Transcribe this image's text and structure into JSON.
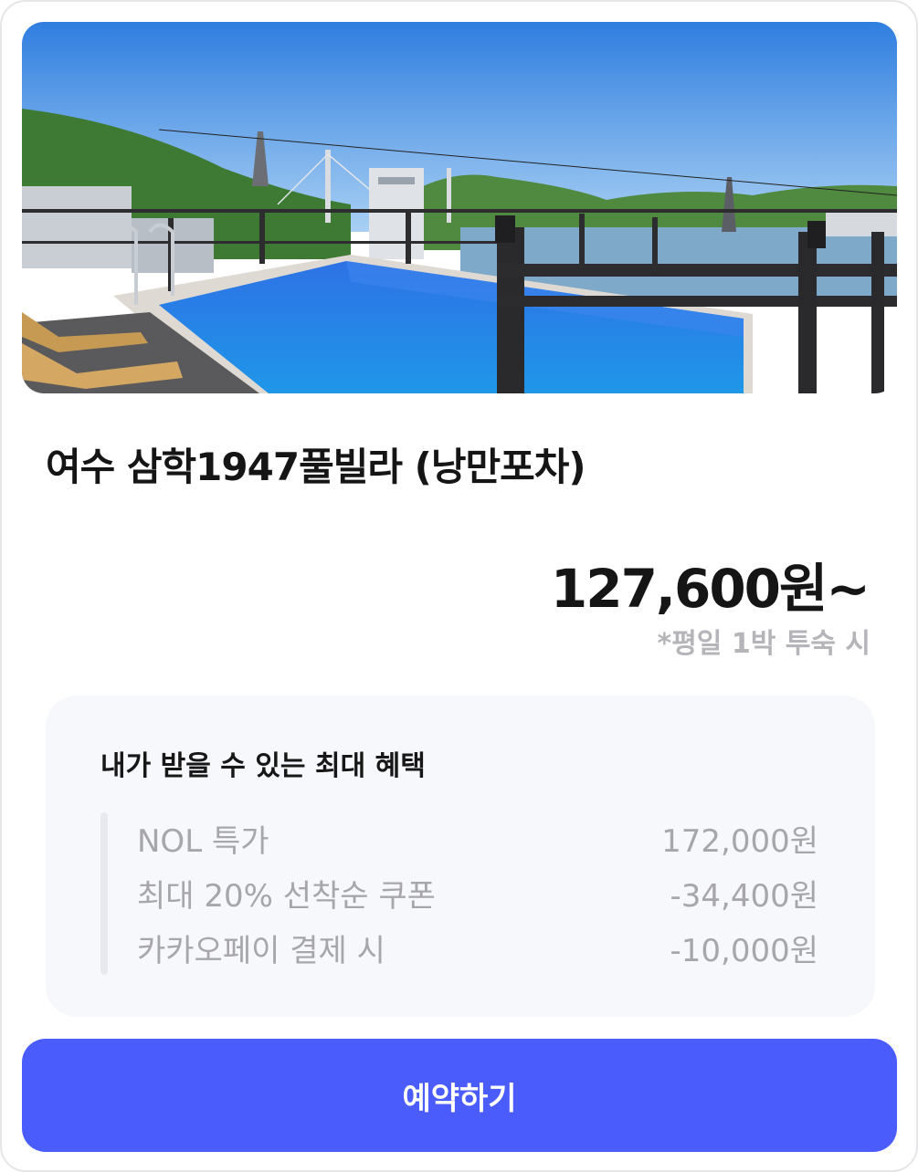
{
  "listing": {
    "title": "여수 삼학1947풀빌라 (낭만포차)",
    "price": "127,600원~",
    "price_note": "*평일 1박 투숙 시"
  },
  "benefits": {
    "title": "내가 받을 수 있는 최대 혜택",
    "items": [
      {
        "label": "NOL 특가",
        "amount": "172,000원"
      },
      {
        "label": "최대 20% 선착순 쿠폰",
        "amount": "-34,400원"
      },
      {
        "label": "카카오페이 결제 시",
        "amount": "-10,000원"
      }
    ]
  },
  "actions": {
    "book_label": "예약하기"
  },
  "colors": {
    "accent": "#4a5cfb",
    "muted_text": "#a7a7ab",
    "benefit_bg": "#f7f8fc"
  }
}
